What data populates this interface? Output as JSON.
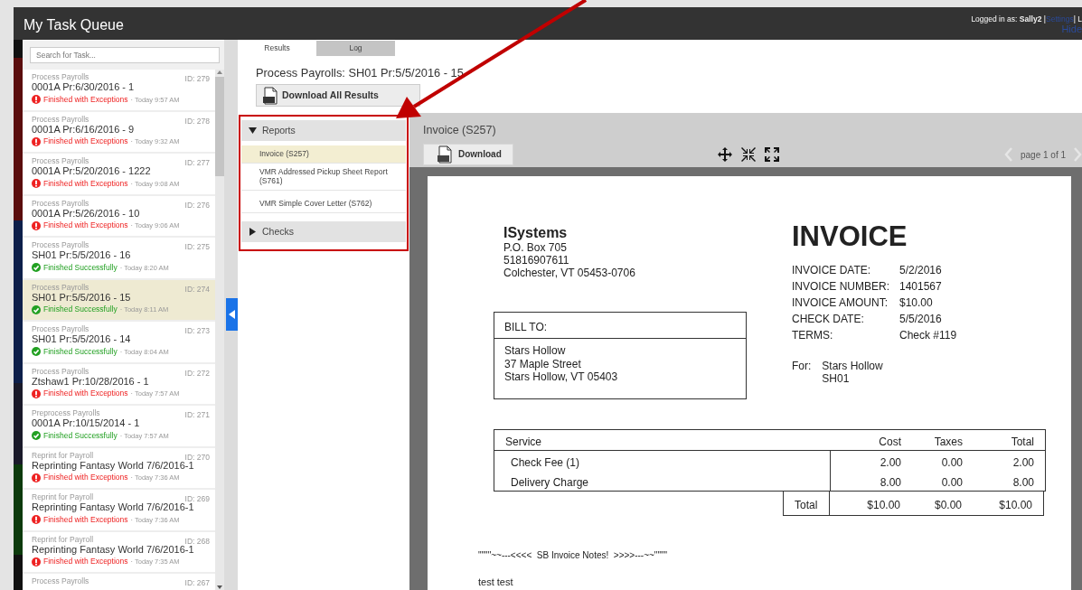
{
  "header": {
    "title": "My Task Queue",
    "logged_in_label": "Logged in as:",
    "user": "Sally2",
    "separator_1": "|",
    "settings_link": "Settings",
    "separator_2": "| L",
    "hide_link": "Hide"
  },
  "task_search": {
    "placeholder": "Search for Task..."
  },
  "tasks": [
    {
      "category": "Process Payrolls",
      "id": "ID: 279",
      "title": "0001A Pr:6/30/2016 - 1",
      "kind": "exception",
      "status": "Finished with Exceptions",
      "time": "· Today 9:57 AM",
      "selected": false
    },
    {
      "category": "Process Payrolls",
      "id": "ID: 278",
      "title": "0001A Pr:6/16/2016 - 9",
      "kind": "exception",
      "status": "Finished with Exceptions",
      "time": "· Today 9:32 AM",
      "selected": false
    },
    {
      "category": "Process Payrolls",
      "id": "ID: 277",
      "title": "0001A Pr:5/20/2016 - 1222",
      "kind": "exception",
      "status": "Finished with Exceptions",
      "time": "· Today 9:08 AM",
      "selected": false
    },
    {
      "category": "Process Payrolls",
      "id": "ID: 276",
      "title": "0001A Pr:5/26/2016 - 10",
      "kind": "exception",
      "status": "Finished with Exceptions",
      "time": "· Today 9:06 AM",
      "selected": false
    },
    {
      "category": "Process Payrolls",
      "id": "ID: 275",
      "title": "SH01 Pr:5/5/2016 - 16",
      "kind": "success",
      "status": "Finished Successfully",
      "time": "· Today 8:20 AM",
      "selected": false
    },
    {
      "category": "Process Payrolls",
      "id": "ID: 274",
      "title": "SH01 Pr:5/5/2016 - 15",
      "kind": "success",
      "status": "Finished Successfully",
      "time": "· Today 8:11 AM",
      "selected": true
    },
    {
      "category": "Process Payrolls",
      "id": "ID: 273",
      "title": "SH01 Pr:5/5/2016 - 14",
      "kind": "success",
      "status": "Finished Successfully",
      "time": "· Today 8:04 AM",
      "selected": false
    },
    {
      "category": "Process Payrolls",
      "id": "ID: 272",
      "title": "Ztshaw1 Pr:10/28/2016 - 1",
      "kind": "exception",
      "status": "Finished with Exceptions",
      "time": "· Today 7:57 AM",
      "selected": false
    },
    {
      "category": "Preprocess Payrolls",
      "id": "ID: 271",
      "title": "0001A Pr:10/15/2014 - 1",
      "kind": "success",
      "status": "Finished Successfully",
      "time": "· Today 7:57 AM",
      "selected": false
    },
    {
      "category": "Reprint for Payroll",
      "id": "ID: 270",
      "title": "Reprinting Fantasy World 7/6/2016-1",
      "kind": "exception",
      "status": "Finished with Exceptions",
      "time": "· Today 7:36 AM",
      "selected": false
    },
    {
      "category": "Reprint for Payroll",
      "id": "ID: 269",
      "title": "Reprinting Fantasy World 7/6/2016-1",
      "kind": "exception",
      "status": "Finished with Exceptions",
      "time": "· Today 7:36 AM",
      "selected": false
    },
    {
      "category": "Reprint for Payroll",
      "id": "ID: 268",
      "title": "Reprinting Fantasy World 7/6/2016-1",
      "kind": "exception",
      "status": "Finished with Exceptions",
      "time": "· Today 7:35 AM",
      "selected": false
    },
    {
      "category": "Process Payrolls",
      "id": "ID: 267",
      "selected": false
    }
  ],
  "result_tabs": [
    {
      "label": "Results",
      "selected": true
    },
    {
      "label": "Log",
      "selected": false
    }
  ],
  "result_title": "Process Payrolls: SH01 Pr:5/5/2016 - 15",
  "download_all_button": "Download All Results",
  "report_groups": [
    {
      "label": "Reports",
      "expanded": true,
      "items": [
        {
          "label": "Invoice (S257)",
          "selected": true
        },
        {
          "label": "VMR Addressed Pickup Sheet Report (S761)",
          "selected": false
        },
        {
          "label": "VMR Simple Cover Letter (S762)",
          "selected": false
        }
      ]
    },
    {
      "label": "Checks",
      "expanded": false
    }
  ],
  "viewer": {
    "title": "Invoice (S257)",
    "download_button": "Download",
    "page_label": "page 1 of 1"
  },
  "invoice": {
    "company_name": "ISystems",
    "company_lines": [
      "P.O. Box 705",
      "51816907611",
      "Colchester, VT  05453-0706"
    ],
    "heading": "INVOICE",
    "details": [
      {
        "label": "INVOICE DATE:",
        "value": "5/2/2016"
      },
      {
        "label": "INVOICE NUMBER:",
        "value": "1401567"
      },
      {
        "label": "INVOICE AMOUNT:",
        "value": "$10.00"
      },
      {
        "label": "CHECK DATE:",
        "value": "5/5/2016"
      },
      {
        "label": "TERMS:",
        "value": "Check #119"
      }
    ],
    "for_label": "For:",
    "for_lines": [
      "Stars Hollow",
      "SH01"
    ],
    "bill_to_label": "BILL TO:",
    "bill_to_lines": [
      "Stars Hollow",
      "37 Maple Street",
      "Stars Hollow, VT  05403"
    ],
    "table": {
      "columns": [
        "Service",
        "Cost",
        "Taxes",
        "Total"
      ],
      "rows": [
        [
          "Check Fee (1)",
          "2.00",
          "0.00",
          "2.00"
        ],
        [
          "Delivery Charge",
          "8.00",
          "0.00",
          "8.00"
        ]
      ],
      "total_row": [
        "Total",
        "$10.00",
        "$0.00",
        "$10.00"
      ]
    },
    "notes": "\"\"\"\"~~---<<<<  SB Invoice Notes!  >>>>---~~\"\"\"\"",
    "memo": "test test"
  }
}
